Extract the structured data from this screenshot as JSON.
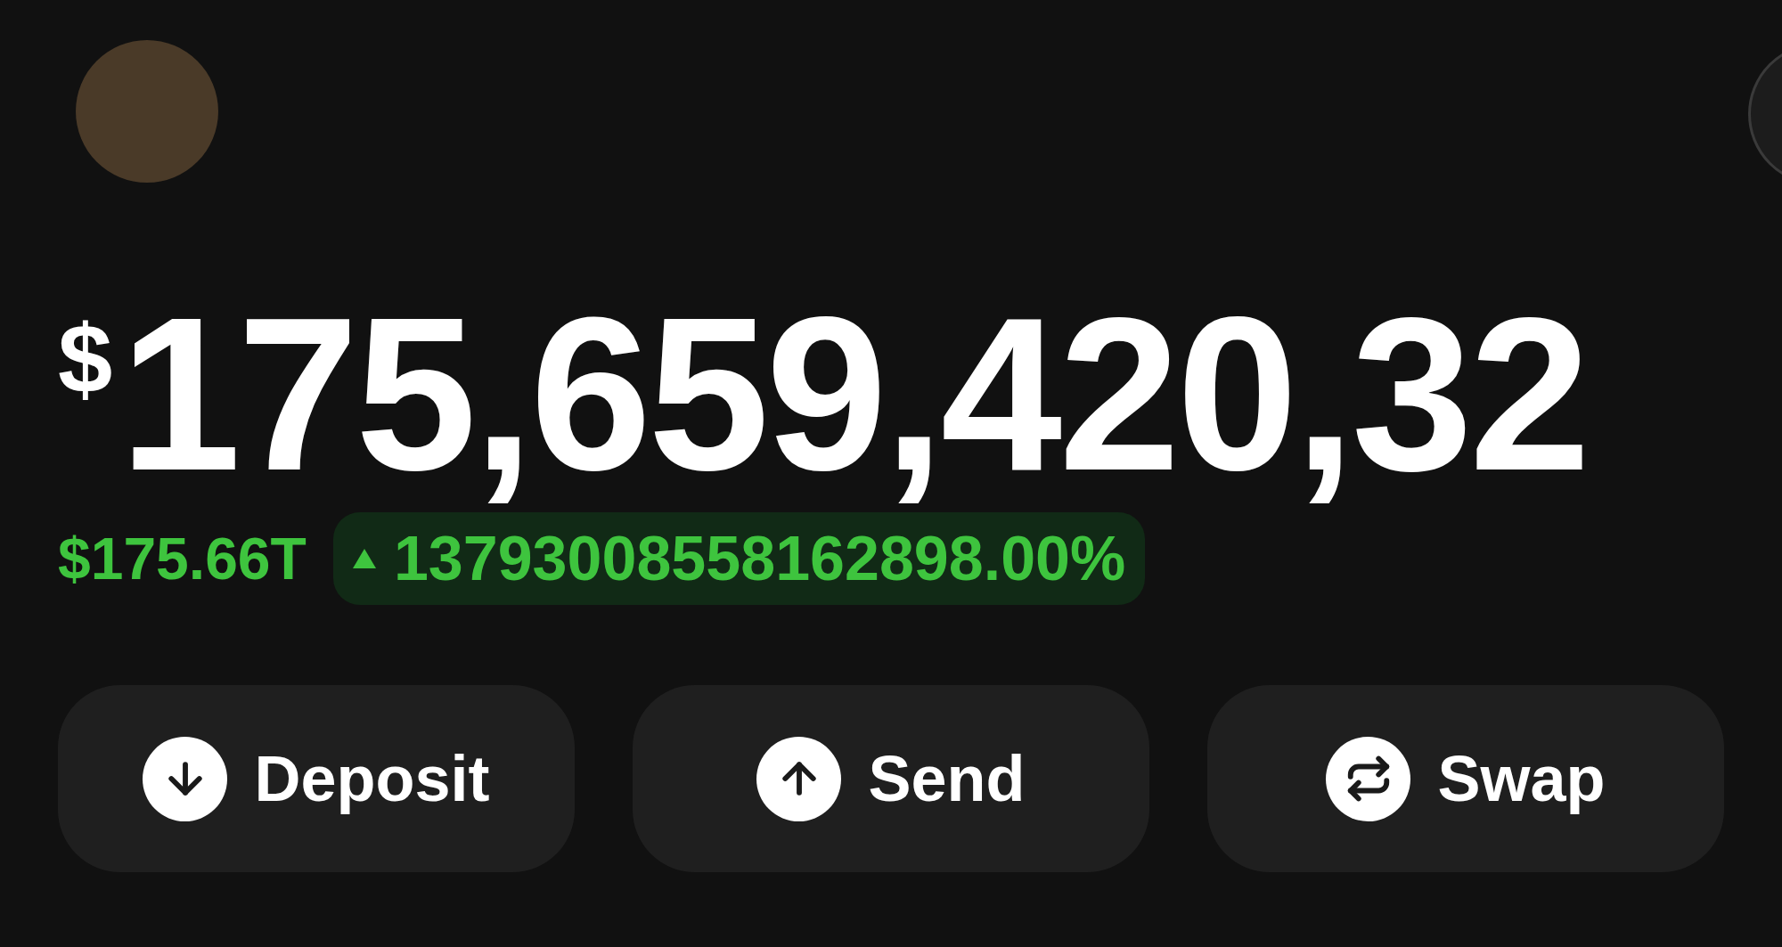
{
  "balance": {
    "currency_symbol": "$",
    "amount": "175,659,420,32"
  },
  "change": {
    "value": "$175.66T",
    "rising": true,
    "percent": "13793008558162898.00%"
  },
  "actions": [
    {
      "kind": "deposit",
      "label": "Deposit"
    },
    {
      "kind": "send",
      "label": "Send"
    },
    {
      "kind": "swap",
      "label": "Swap"
    }
  ]
}
